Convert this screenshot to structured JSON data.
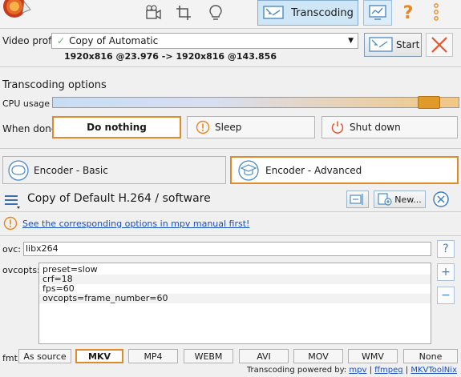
{
  "toolbar": {
    "active_tab_label": "Transcoding",
    "help_glyph": "?",
    "icons": [
      "app-logo",
      "video-camera-icon",
      "crop-icon",
      "lightbulb-icon",
      "transcoding-icon",
      "monitor-chart-icon",
      "help-icon",
      "more-options-icon"
    ]
  },
  "video_profile": {
    "label": "Video profile:",
    "value": "Copy of Automatic",
    "subtitle": "1920x816 @23.976 -> 1920x816 @143.856",
    "start_label": "Start"
  },
  "transcoding_options": {
    "title": "Transcoding options",
    "cpu_label": "CPU usage",
    "cpu_level_fraction": 0.95,
    "when_done_label": "When done",
    "buttons": [
      "Do nothing",
      "Sleep",
      "Shut down"
    ],
    "selected": "Do nothing"
  },
  "encoder_tabs": {
    "basic": "Encoder - Basic",
    "advanced": "Encoder - Advanced",
    "selected": "advanced"
  },
  "preset": {
    "name": "Copy of Default H.264 / software",
    "new_label": "New..."
  },
  "warning": {
    "link_text": "See the corresponding options in mpv manual first!"
  },
  "ovc": {
    "label": "ovc:",
    "value": "libx264",
    "help_glyph": "?"
  },
  "ovcopts": {
    "label": "ovcopts:",
    "lines": [
      "preset=slow",
      "crf=18",
      "fps=60",
      "ovcopts=frame_number=60"
    ],
    "add_glyph": "+",
    "remove_glyph": "−"
  },
  "fmt": {
    "label": "fmt:",
    "options": [
      "As source",
      "MKV",
      "MP4",
      "WEBM",
      "AVI",
      "MOV",
      "WMV",
      "None"
    ],
    "selected": "MKV"
  },
  "footer": {
    "prefix": "Transcoding powered by:",
    "links": [
      "mpv",
      "ffmpeg",
      "MKVToolNix"
    ],
    "separator": "|"
  },
  "colors": {
    "accent_orange": "#e08a2a",
    "warning_orange": "#e8871e",
    "close_red": "#e8552a",
    "link_blue": "#1a4fbf"
  }
}
